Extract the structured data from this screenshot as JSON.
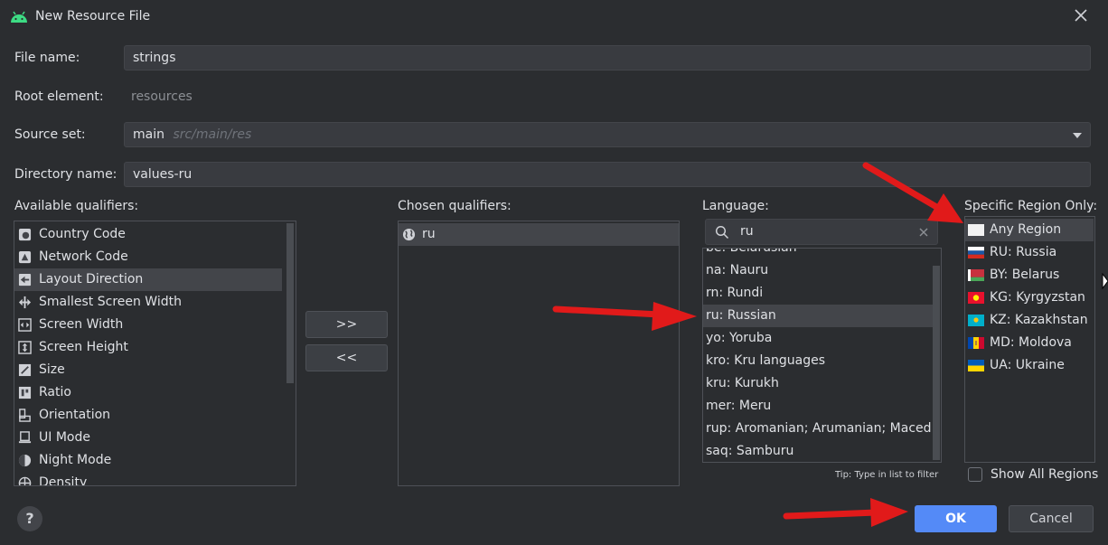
{
  "window": {
    "title": "New Resource File"
  },
  "form": {
    "file_name_label": "File name:",
    "file_name_value": "strings",
    "root_element_label": "Root element:",
    "root_element_value": "resources",
    "source_set_label": "Source set:",
    "source_set_value": "main",
    "source_set_path": "src/main/res",
    "directory_name_label": "Directory name:",
    "directory_name_value": "values-ru"
  },
  "available": {
    "label": "Available qualifiers:",
    "items": [
      {
        "label": "Country Code",
        "icon": "country-code-icon"
      },
      {
        "label": "Network Code",
        "icon": "network-code-icon"
      },
      {
        "label": "Layout Direction",
        "icon": "layout-direction-icon",
        "selected": true
      },
      {
        "label": "Smallest Screen Width",
        "icon": "smallest-width-icon"
      },
      {
        "label": "Screen Width",
        "icon": "screen-width-icon"
      },
      {
        "label": "Screen Height",
        "icon": "screen-height-icon"
      },
      {
        "label": "Size",
        "icon": "size-icon"
      },
      {
        "label": "Ratio",
        "icon": "ratio-icon"
      },
      {
        "label": "Orientation",
        "icon": "orientation-icon"
      },
      {
        "label": "UI Mode",
        "icon": "ui-mode-icon"
      },
      {
        "label": "Night Mode",
        "icon": "night-mode-icon"
      },
      {
        "label": "Density",
        "icon": "density-icon"
      }
    ]
  },
  "transfer": {
    "add_label": ">>",
    "remove_label": "<<"
  },
  "chosen": {
    "label": "Chosen qualifiers:",
    "items": [
      {
        "label": "ru",
        "icon": "globe-icon"
      }
    ]
  },
  "language": {
    "label": "Language:",
    "search_value": "ru",
    "items": [
      "be: Belarusian",
      "na: Nauru",
      "rn: Rundi",
      "ru: Russian",
      "yo: Yoruba",
      "kro: Kru languages",
      "kru: Kurukh",
      "mer: Meru",
      "rup: Aromanian; Arumanian; Maced…",
      "saq: Samburu"
    ],
    "selected_index": 3,
    "tip": "Tip: Type in list to filter"
  },
  "region": {
    "label": "Specific Region Only:",
    "items": [
      {
        "label": "Any Region",
        "flag": "blank"
      },
      {
        "label": "RU: Russia",
        "flag": "ru"
      },
      {
        "label": "BY: Belarus",
        "flag": "by"
      },
      {
        "label": "KG: Kyrgyzstan",
        "flag": "kg"
      },
      {
        "label": "KZ: Kazakhstan",
        "flag": "kz"
      },
      {
        "label": "MD: Moldova",
        "flag": "md"
      },
      {
        "label": "UA: Ukraine",
        "flag": "ua"
      }
    ],
    "show_all_label": "Show All Regions"
  },
  "footer": {
    "help_label": "?",
    "ok_label": "OK",
    "cancel_label": "Cancel"
  },
  "colors": {
    "accent": "#548af7",
    "background": "#2b2d30",
    "annotation_arrow": "#e11a1a"
  }
}
